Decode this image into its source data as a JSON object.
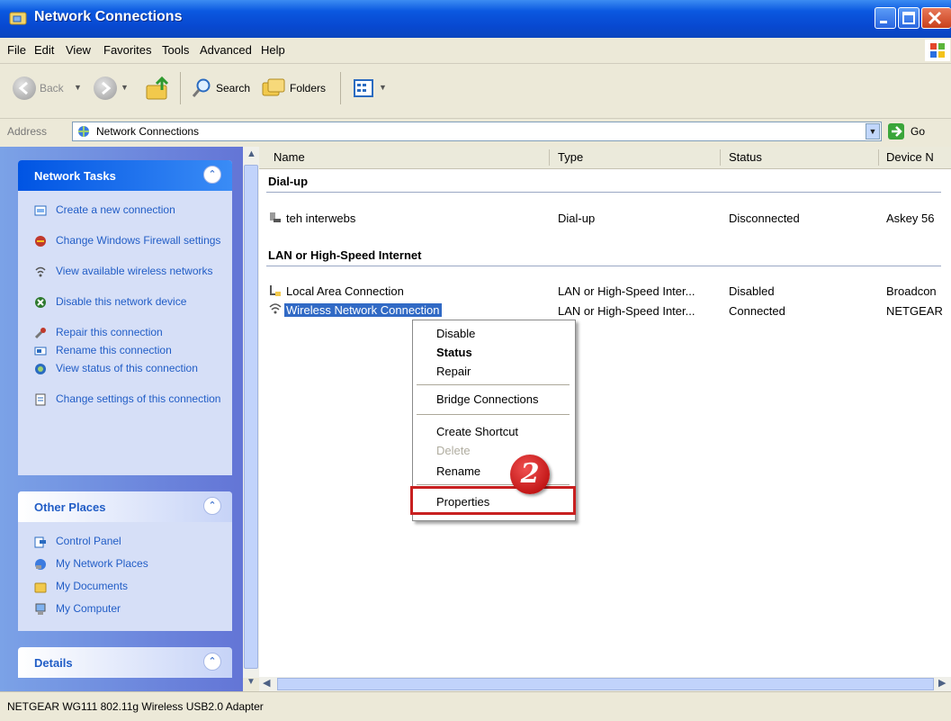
{
  "window": {
    "title": "Network Connections"
  },
  "menu": [
    "File",
    "Edit",
    "View",
    "Favorites",
    "Tools",
    "Advanced",
    "Help"
  ],
  "toolbar": {
    "back": "Back",
    "search": "Search",
    "folders": "Folders"
  },
  "address": {
    "label": "Address",
    "value": "Network Connections",
    "go": "Go"
  },
  "left": {
    "network_tasks": {
      "title": "Network Tasks",
      "items": [
        "Create a new connection",
        "Change Windows Firewall settings",
        "View available wireless networks",
        "Disable this network device",
        "Repair this connection",
        "Rename this connection",
        "View status of this connection",
        "Change settings of this connection"
      ]
    },
    "other_places": {
      "title": "Other Places",
      "items": [
        "Control Panel",
        "My Network Places",
        "My Documents",
        "My Computer"
      ]
    },
    "details": {
      "title": "Details"
    }
  },
  "columns": [
    "Name",
    "Type",
    "Status",
    "Device N"
  ],
  "groups": {
    "dialup": "Dial-up",
    "lan": "LAN or High-Speed Internet"
  },
  "rows": [
    {
      "name": "teh interwebs",
      "type": "Dial-up",
      "status": "Disconnected",
      "device": "Askey 56"
    },
    {
      "name": "Local Area Connection",
      "type": "LAN or High-Speed Inter...",
      "status": "Disabled",
      "device": "Broadcon"
    },
    {
      "name": "Wireless Network Connection",
      "type": "LAN or High-Speed Inter...",
      "status": "Connected",
      "device": "NETGEAR"
    }
  ],
  "context_menu": {
    "disable": "Disable",
    "status": "Status",
    "repair": "Repair",
    "bridge": "Bridge Connections",
    "shortcut": "Create Shortcut",
    "delete": "Delete",
    "rename": "Rename",
    "properties": "Properties"
  },
  "callout": "2",
  "statusbar": "NETGEAR WG111 802.11g Wireless USB2.0 Adapter",
  "colors": {
    "titlebar": "#0A58E0",
    "selection": "#316AC5",
    "highlight_box": "#c82020",
    "task_text": "#215DC6"
  }
}
